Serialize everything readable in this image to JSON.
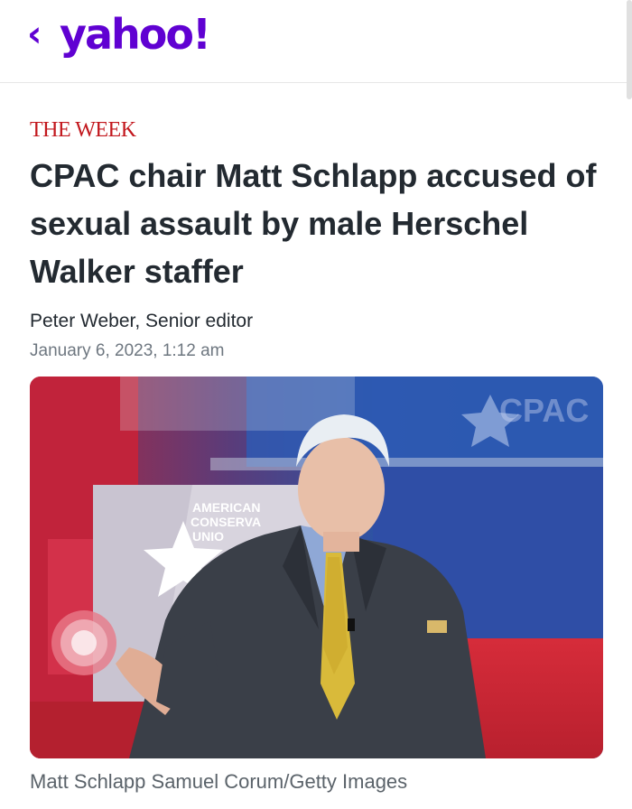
{
  "header": {
    "back_icon": "chevron-left-icon",
    "logo_text": "yahoo!",
    "brand_color": "#6001d2"
  },
  "article": {
    "source": "THE WEEK",
    "headline": "CPAC chair Matt Schlapp accused of sexual assault by male Herschel Walker staffer",
    "author": "Peter Weber, Senior editor",
    "date": "January 6, 2023, 1:12 am",
    "photo_caption": "Matt Schlapp Samuel Corum/Getty Images",
    "photo_text": {
      "backdrop_logo": "CPAC",
      "podium_text": "AMERICAN CONSERVATIVE UNION"
    }
  }
}
